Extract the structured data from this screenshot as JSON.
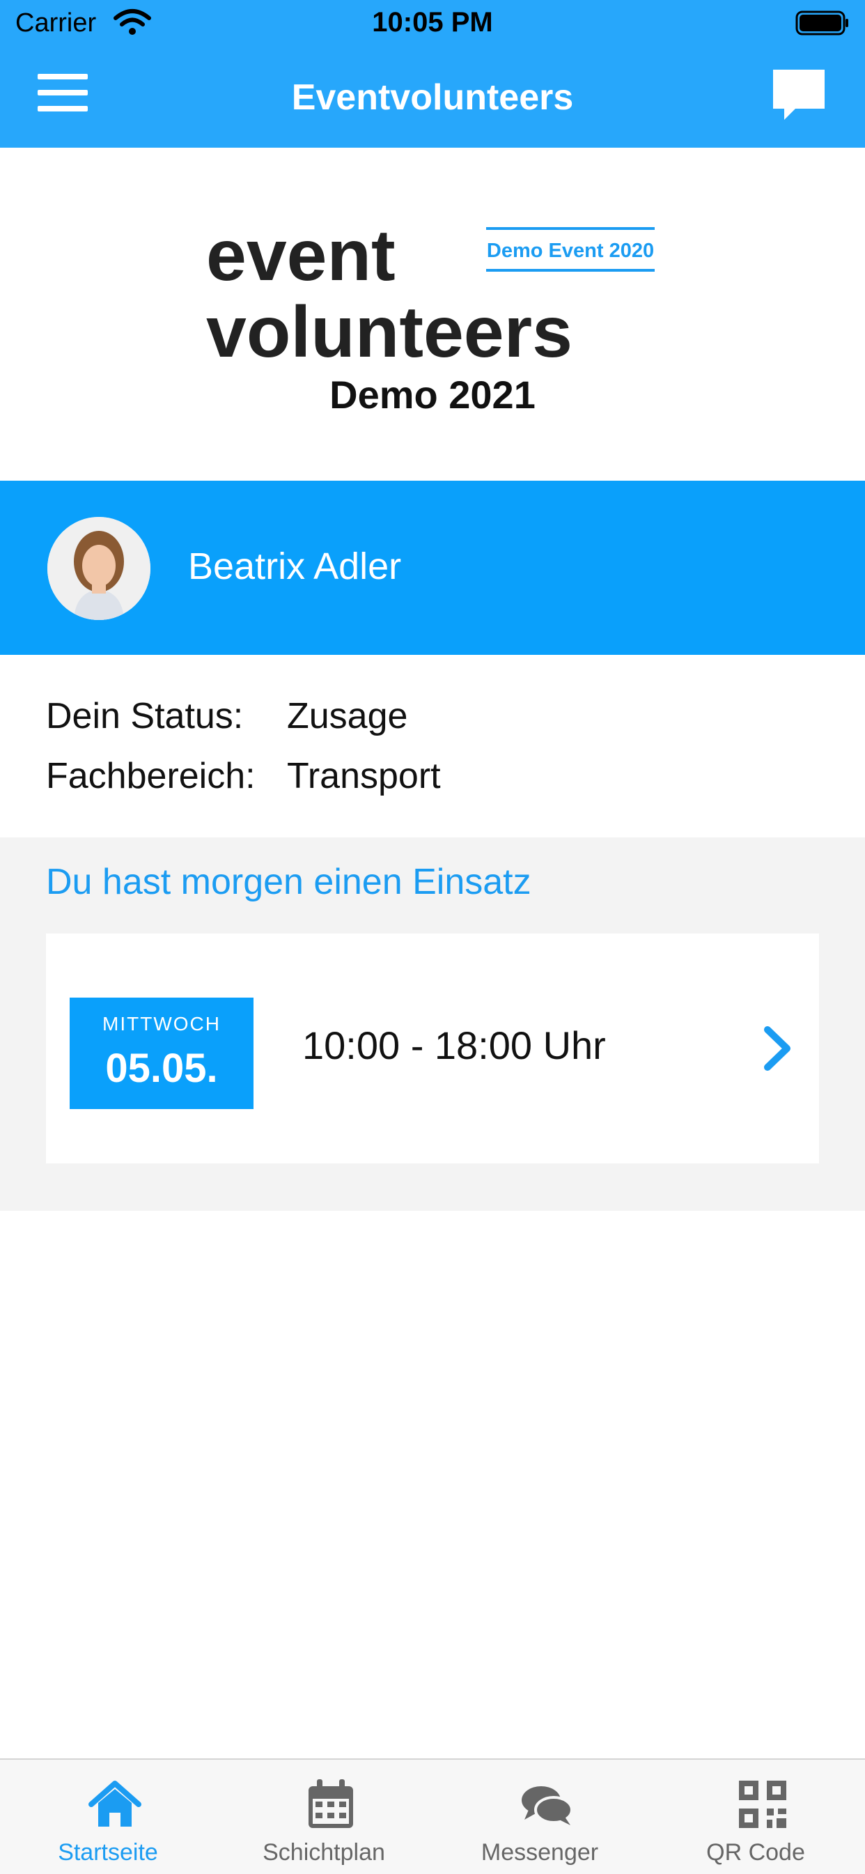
{
  "status_bar": {
    "carrier": "Carrier",
    "time": "10:05 PM"
  },
  "nav": {
    "title": "Eventvolunteers"
  },
  "logo": {
    "line1": "event",
    "line2": "volunteers",
    "badge": "Demo Event 2020",
    "subtitle": "Demo 2021"
  },
  "profile": {
    "name": "Beatrix Adler"
  },
  "info": {
    "status_label": "Dein Status:",
    "status_value": "Zusage",
    "area_label": "Fachbereich:",
    "area_value": "Transport"
  },
  "shift": {
    "heading": "Du hast morgen einen Einsatz",
    "weekday": "MITTWOCH",
    "date": "05.05.",
    "time": "10:00 - 18:00 Uhr"
  },
  "tabs": [
    {
      "label": "Startseite",
      "icon": "home-icon",
      "active": true
    },
    {
      "label": "Schichtplan",
      "icon": "calendar-icon",
      "active": false
    },
    {
      "label": "Messenger",
      "icon": "chat-bubbles-icon",
      "active": false
    },
    {
      "label": "QR Code",
      "icon": "qr-code-icon",
      "active": false
    }
  ],
  "colors": {
    "primary": "#27a7fb",
    "banner": "#0aa0fb",
    "accent": "#1b9cf2",
    "logo_dark": "#222222"
  }
}
